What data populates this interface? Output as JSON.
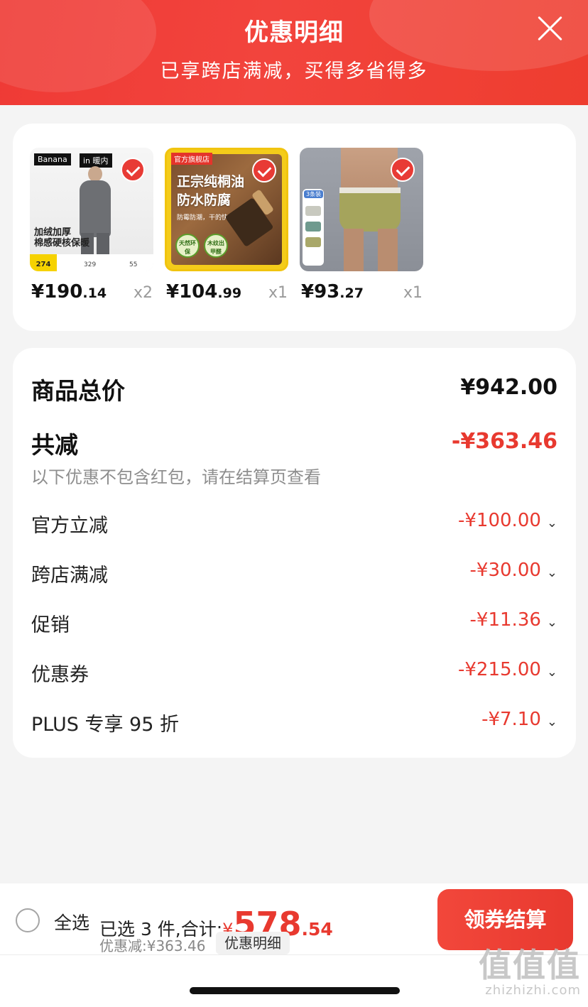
{
  "header": {
    "title": "优惠明细",
    "subtitle": "已享跨店满减，买得多省得多",
    "close_icon": "close-icon"
  },
  "products": [
    {
      "price_int": "¥190",
      "price_dec": ".14",
      "qty": "x2",
      "checked": true,
      "image": {
        "brand": "Banana",
        "brand2": "in 暖内",
        "tag_line1": "加绒加厚",
        "tag_line2": "棉感硬核保暖",
        "box_num": "274",
        "mini1": "329",
        "mini2": "55"
      }
    },
    {
      "price_int": "¥104",
      "price_dec": ".99",
      "qty": "x1",
      "checked": true,
      "image": {
        "logo": "官方旗舰店",
        "headline1": "正宗纯桐油",
        "headline2": "防水防腐",
        "small": "防霉防潮，干的快",
        "badge1": "天然环保",
        "badge2": "木纹出甲醛"
      }
    },
    {
      "price_int": "¥93",
      "price_dec": ".27",
      "qty": "x1",
      "checked": true,
      "image": {
        "swatch_tag": "3条装"
      }
    }
  ],
  "summary": {
    "total_label": "商品总价",
    "total_value": "¥942.00",
    "reduce_label": "共减",
    "reduce_value": "-¥363.46",
    "note": "以下优惠不包含红包，请在结算页查看",
    "items": [
      {
        "label": "官方立减",
        "value": "-¥100.00"
      },
      {
        "label": "跨店满减",
        "value": "-¥30.00"
      },
      {
        "label": "促销",
        "value": "-¥11.36"
      },
      {
        "label": "优惠券",
        "value": "-¥215.00"
      },
      {
        "label": "PLUS 专享 95 折",
        "value": "-¥7.10"
      }
    ]
  },
  "bottom": {
    "select_all": "全选",
    "selected_text": "已选 3 件,合计:",
    "yen": "¥",
    "amount_int": "578",
    "amount_dec": ".54",
    "discount_text": "优惠减:¥363.46",
    "detail_button": "优惠明细",
    "checkout_button": "领券结算"
  },
  "watermark": {
    "glyphs": "值值值",
    "url": "zhizhizhi.com"
  },
  "colors": {
    "accent_red": "#e8392f",
    "header_red": "#ef3a35",
    "background": "#f4f4f4"
  }
}
